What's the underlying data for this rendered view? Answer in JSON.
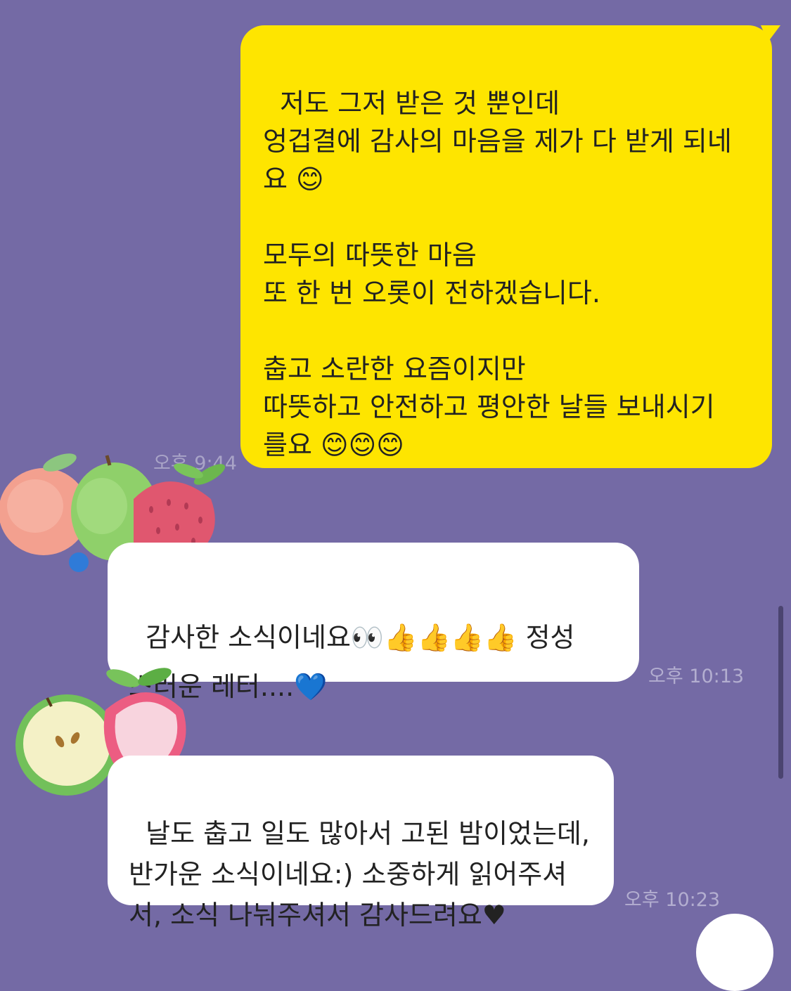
{
  "messages": [
    {
      "sender": "me",
      "text": "저도 그저 받은 것 뿐인데\n엉겁결에 감사의 마음을 제가 다 받게 되네\n요 😊\n\n모두의 따뜻한 마음\n또 한 번 오롯이 전하겠습니다.\n\n춥고 소란한 요즘이지만\n따뜻하고 안전하고 평안한 날들 보내시기\n를요 😊😊😊",
      "time": "오후 9:44"
    },
    {
      "sender": "other",
      "text": "감사한 소식이네요👀👍👍👍👍 정성\n스러운 레터....💙",
      "time": "오후 10:13"
    },
    {
      "sender": "other",
      "text": "날도 춥고 일도 많아서 고된 밤이었는데,\n반가운 소식이네요:) 소중하게 읽어주셔\n서, 소식 나눠주셔서 감사드려요♥",
      "time": "오후 10:23"
    }
  ],
  "avatars": [
    {
      "name": "peach-apple-strawberry-avatar"
    },
    {
      "name": "apple-strawberry-avatar"
    }
  ],
  "colors": {
    "background": "#746aa5",
    "my_bubble": "#fee500",
    "other_bubble": "#ffffff"
  }
}
